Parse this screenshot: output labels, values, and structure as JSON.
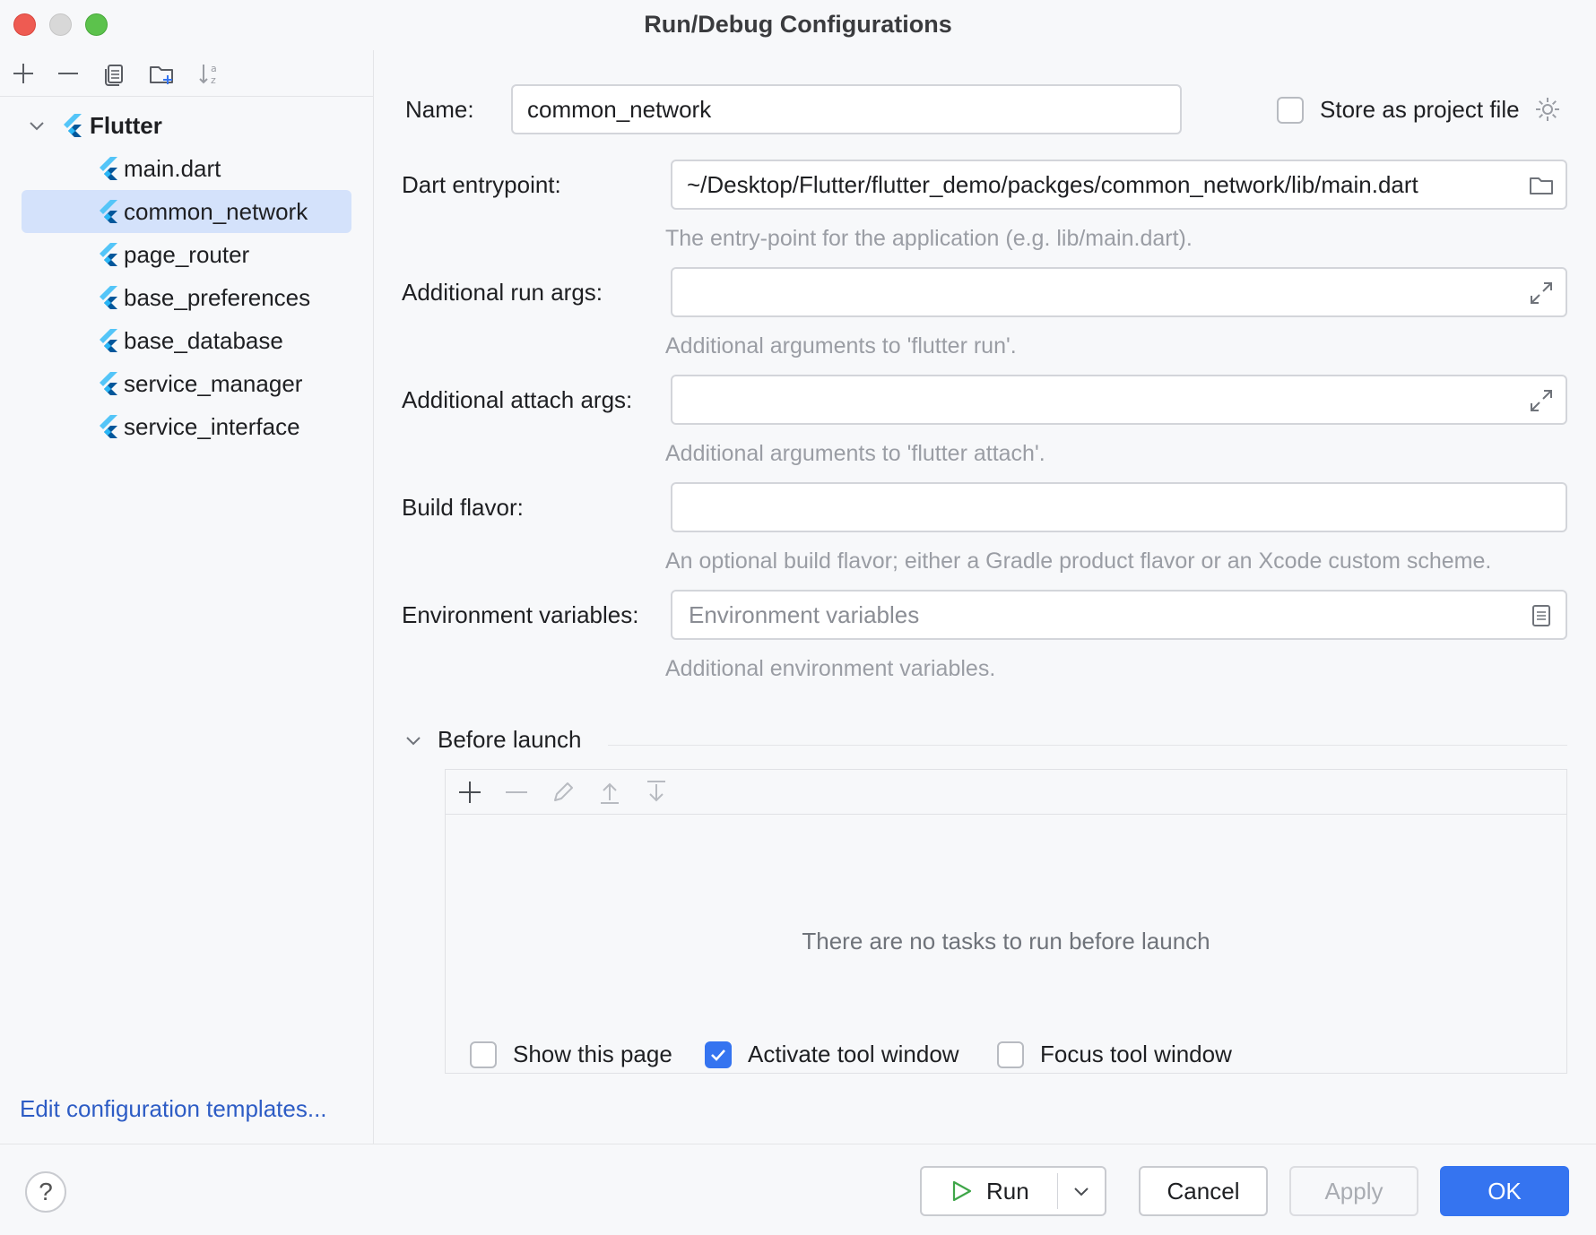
{
  "window": {
    "title": "Run/Debug Configurations"
  },
  "tree": {
    "group_label": "Flutter",
    "items": [
      {
        "label": "main.dart"
      },
      {
        "label": "common_network"
      },
      {
        "label": "page_router"
      },
      {
        "label": "base_preferences"
      },
      {
        "label": "base_database"
      },
      {
        "label": "service_manager"
      },
      {
        "label": "service_interface"
      }
    ],
    "selected": "common_network"
  },
  "edit_templates_link": "Edit configuration templates...",
  "form": {
    "name_label": "Name:",
    "name_value": "common_network",
    "store_label": "Store as project file",
    "dart_label": "Dart entrypoint:",
    "dart_value": "~/Desktop/Flutter/flutter_demo/packges/common_network/lib/main.dart",
    "dart_hint": "The entry-point for the application (e.g. lib/main.dart).",
    "run_args_label": "Additional run args:",
    "run_args_value": "",
    "run_args_hint": "Additional arguments to 'flutter run'.",
    "attach_args_label": "Additional attach args:",
    "attach_args_value": "",
    "attach_args_hint": "Additional arguments to 'flutter attach'.",
    "flavor_label": "Build flavor:",
    "flavor_value": "",
    "flavor_hint": "An optional build flavor; either a Gradle product flavor or an Xcode custom scheme.",
    "env_label": "Environment variables:",
    "env_placeholder": "Environment variables",
    "env_hint": "Additional environment variables."
  },
  "before_launch": {
    "title": "Before launch",
    "empty_text": "There are no tasks to run before launch",
    "show_page_label": "Show this page",
    "activate_label": "Activate tool window",
    "focus_label": "Focus tool window"
  },
  "footer": {
    "help": "?",
    "run": "Run",
    "cancel": "Cancel",
    "apply": "Apply",
    "ok": "OK"
  },
  "colors": {
    "accent": "#3574f0",
    "selection": "#d4e2fb",
    "link": "#2d5cc5"
  }
}
